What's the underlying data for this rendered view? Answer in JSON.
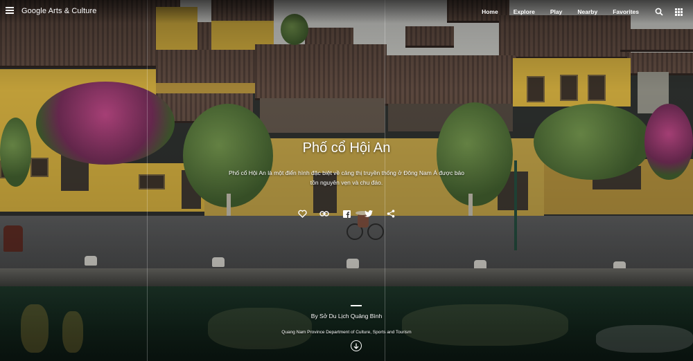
{
  "app": {
    "logo_text": "Google Arts & Culture"
  },
  "nav": {
    "items": [
      {
        "label": "Home"
      },
      {
        "label": "Explore"
      },
      {
        "label": "Play"
      },
      {
        "label": "Nearby"
      },
      {
        "label": "Favorites"
      }
    ],
    "icons": [
      "search-icon",
      "apps-grid-icon"
    ]
  },
  "hero": {
    "title": "Phố cổ Hội An",
    "description": "Phố cổ Hội An là một điển hình đặc biệt về cảng thị truyền thống ở Đông Nam Á được bảo tồn nguyên vẹn và chu đáo.",
    "actions": [
      "favorite-icon",
      "link-icon",
      "facebook-icon",
      "twitter-icon",
      "share-icon"
    ]
  },
  "credits": {
    "byline": "By Sở Du Lịch Quảng Bình",
    "publisher": "Quang Nam Province Department of Culture, Sports and Tourism"
  },
  "colors": {
    "text": "#ffffff",
    "wall_yellow": "#c9a63c",
    "roof": "#4a3a33",
    "river": "#1f3a2c"
  }
}
